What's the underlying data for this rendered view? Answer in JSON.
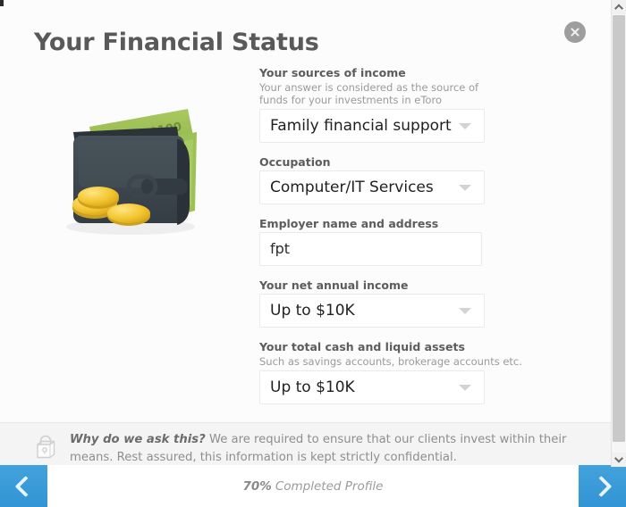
{
  "modal": {
    "title": "Your Financial Status",
    "close_icon": "close-icon"
  },
  "illustration": {
    "name": "wallet-illustration",
    "banknote_label": "$100"
  },
  "form": {
    "fields": [
      {
        "label": "Your sources of income",
        "hint": "Your answer is considered as the source of funds for your investments in eToro",
        "type": "select",
        "value": "Family financial support"
      },
      {
        "label": "Occupation",
        "hint": "",
        "type": "select",
        "value": "Computer/IT Services"
      },
      {
        "label": "Employer name and address",
        "hint": "",
        "type": "text",
        "value": "fpt"
      },
      {
        "label": "Your net annual income",
        "hint": "",
        "type": "select",
        "value": "Up to $10K"
      },
      {
        "label": "Your total cash and liquid assets",
        "hint": "Such as savings accounts, brokerage accounts etc.",
        "type": "select",
        "value": "Up to $10K"
      }
    ]
  },
  "disclaimer": {
    "lock_icon": "lock-icon",
    "heading": "Why do we ask this?",
    "body": " We are required to ensure that our clients invest within their means. Rest assured, this information is kept strictly confidential."
  },
  "footer": {
    "prev_label": "",
    "next_label": "",
    "prev_icon": "chevron-left-icon",
    "next_icon": "chevron-right-icon",
    "progress_percent": "70%",
    "progress_label": "Completed Profile"
  },
  "scrollbar": {
    "up_icon": "chevron-up-icon",
    "down_icon": "chevron-down-icon"
  },
  "colors": {
    "accent_blue": "#3a9ad9",
    "title_gray": "#595959",
    "band_gray": "#f4f4f4"
  }
}
